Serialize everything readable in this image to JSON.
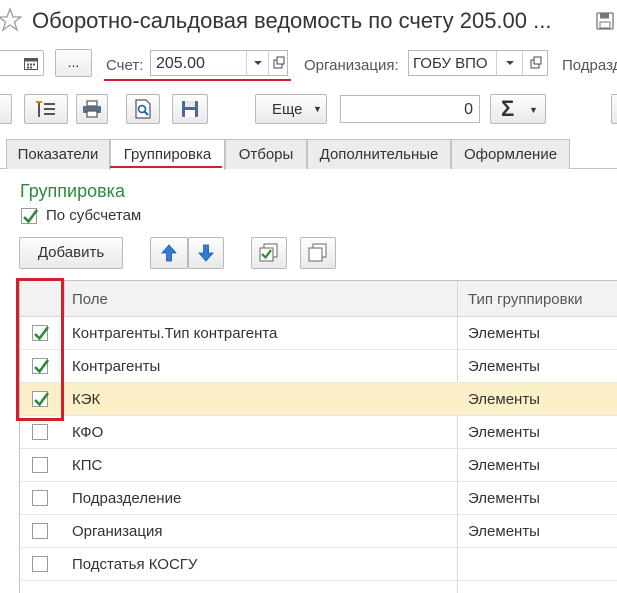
{
  "window": {
    "title": "Оборотно-сальдовая ведомость по счету 205.00 ..."
  },
  "filters": {
    "more_dots": "...",
    "account_label": "Счет:",
    "account_value": "205.00",
    "org_label": "Организация:",
    "org_value": "ГОБУ ВПО",
    "division_label": "Подраздел"
  },
  "toolbar": {
    "more_label": "Еще",
    "sum_value": "0",
    "sigma": "Σ"
  },
  "tabs": [
    {
      "label": "Показатели",
      "active": false
    },
    {
      "label": "Группировка",
      "active": true
    },
    {
      "label": "Отборы",
      "active": false
    },
    {
      "label": "Дополнительные",
      "active": false
    },
    {
      "label": "Оформление",
      "active": false
    }
  ],
  "grouping": {
    "title": "Группировка",
    "by_subaccounts_label": "По субсчетам",
    "by_subaccounts_checked": true,
    "add_label": "Добавить"
  },
  "table": {
    "columns": [
      "Поле",
      "Тип группировки"
    ],
    "rows": [
      {
        "checked": true,
        "field": "Контрагенты.Тип контрагента",
        "type": "Элементы",
        "selected": false
      },
      {
        "checked": true,
        "field": "Контрагенты",
        "type": "Элементы",
        "selected": false
      },
      {
        "checked": true,
        "field": "КЭК",
        "type": "Элементы",
        "selected": true
      },
      {
        "checked": false,
        "field": "КФО",
        "type": "Элементы",
        "selected": false
      },
      {
        "checked": false,
        "field": "КПС",
        "type": "Элементы",
        "selected": false
      },
      {
        "checked": false,
        "field": "Подразделение",
        "type": "Элементы",
        "selected": false
      },
      {
        "checked": false,
        "field": "Организация",
        "type": "Элементы",
        "selected": false
      },
      {
        "checked": false,
        "field": "Подстатья КОСГУ",
        "type": "",
        "selected": false
      }
    ]
  },
  "colors": {
    "accent_green": "#2d8a3c",
    "highlight_red": "#d31f2b",
    "selected_row": "#fbf0c8"
  }
}
